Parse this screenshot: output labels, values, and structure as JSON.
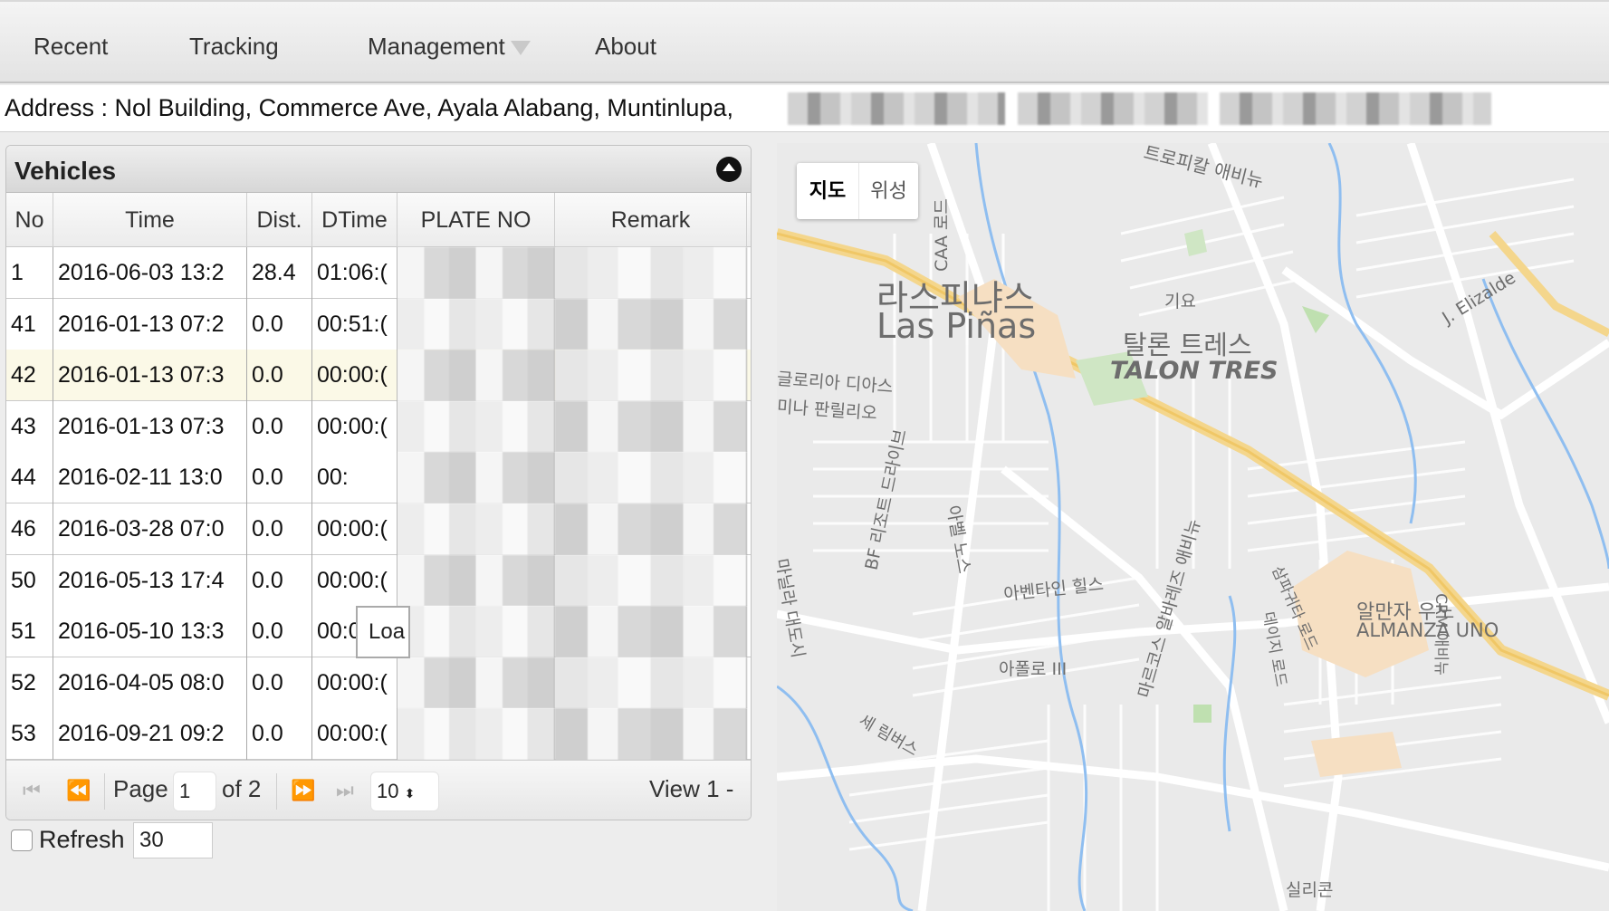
{
  "menu": {
    "items": [
      "Recent",
      "Tracking",
      "Management",
      "About"
    ]
  },
  "address": {
    "text": "Address : Nol Building, Commerce Ave, Ayala Alabang, Muntinlupa,"
  },
  "panel": {
    "title": "Vehicles",
    "columns": [
      "No",
      "Time",
      "Dist.",
      "DTime",
      "PLATE NO",
      "Remark"
    ],
    "rows": [
      {
        "no": "1",
        "time": "2016-06-03 13:2",
        "dist": "28.4",
        "dtime": "01:06:("
      },
      {
        "no": "41",
        "time": "2016-01-13 07:2",
        "dist": "0.0",
        "dtime": "00:51:("
      },
      {
        "no": "42",
        "time": "2016-01-13 07:3",
        "dist": "0.0",
        "dtime": "00:00:("
      },
      {
        "no": "43",
        "time": "2016-01-13 07:3",
        "dist": "0.0",
        "dtime": "00:00:("
      },
      {
        "no": "44",
        "time": "2016-02-11 13:0",
        "dist": "0.0",
        "dtime": "00:"
      },
      {
        "no": "46",
        "time": "2016-03-28 07:0",
        "dist": "0.0",
        "dtime": "00:00:("
      },
      {
        "no": "50",
        "time": "2016-05-13 17:4",
        "dist": "0.0",
        "dtime": "00:00:("
      },
      {
        "no": "51",
        "time": "2016-05-10 13:3",
        "dist": "0.0",
        "dtime": "00:00:("
      },
      {
        "no": "52",
        "time": "2016-04-05 08:0",
        "dist": "0.0",
        "dtime": "00:00:("
      },
      {
        "no": "53",
        "time": "2016-09-21 09:2",
        "dist": "0.0",
        "dtime": "00:00:("
      }
    ],
    "loading_text": "Loa",
    "pager": {
      "page_label": "Page",
      "page_value": "1",
      "of_label": "of 2",
      "page_size": "10",
      "view_text": "View 1 -"
    }
  },
  "refresh": {
    "label": "Refresh",
    "value": "30"
  },
  "map": {
    "toggle": [
      "지도",
      "위성"
    ],
    "labels": [
      "라스피냐스",
      "Las Piñas",
      "탈론 트레스",
      "TALON TRES",
      "알만자 우노",
      "ALMANZA UNO",
      "트로피칼 애비뉴",
      "CAA 로드",
      "기요",
      "J. Elizalde",
      "글로리아 디아스",
      "미나 판릴리오",
      "BF 리조트 드라이브",
      "아벤타인 힐스",
      "아폴로 III",
      "실리콘",
      "마르코스 알바레즈 애비뉴",
      "CRM 애비뉴",
      "데이지 로드",
      "삼파귀타 로드",
      "아벨 노스",
      "세 림버스",
      "마닐라 대도시"
    ]
  }
}
